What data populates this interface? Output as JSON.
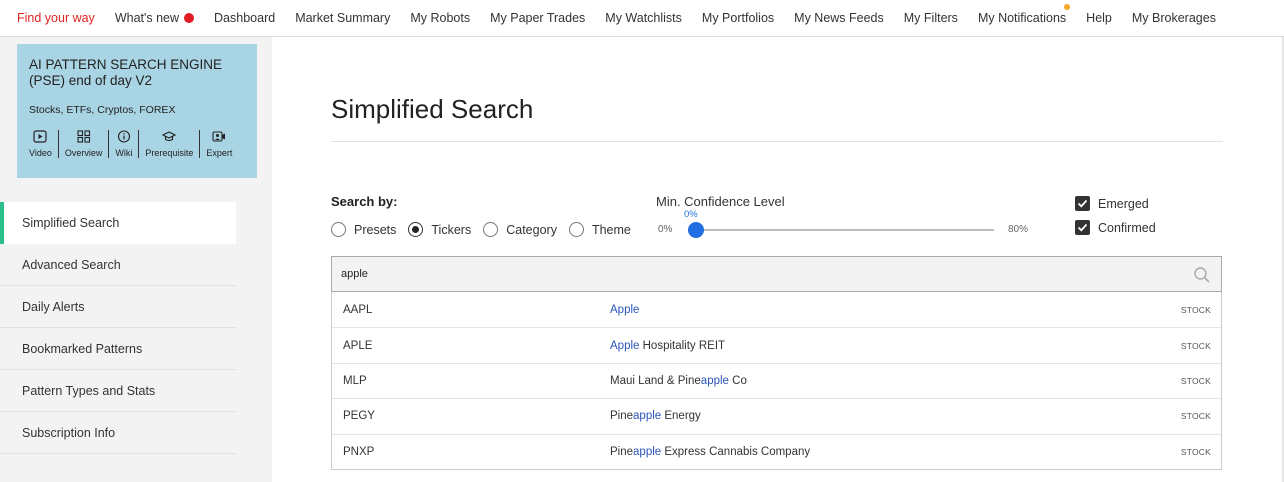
{
  "topnav": {
    "items": [
      {
        "label": "Find your way"
      },
      {
        "label": "What's new"
      },
      {
        "label": "Dashboard"
      },
      {
        "label": "Market Summary"
      },
      {
        "label": "My Robots"
      },
      {
        "label": "My Paper Trades"
      },
      {
        "label": "My Watchlists"
      },
      {
        "label": "My Portfolios"
      },
      {
        "label": "My News Feeds"
      },
      {
        "label": "My Filters"
      },
      {
        "label": "My Notifications"
      },
      {
        "label": "Help"
      },
      {
        "label": "My Brokerages"
      }
    ],
    "accent_color": "#e02424",
    "new_dot_color": "#e31b23",
    "notif_dot_color": "#f5a623"
  },
  "pse_card": {
    "title": "AI PATTERN SEARCH ENGINE (PSE) end of day V2",
    "subtitle": "Stocks, ETFs, Cryptos, FOREX",
    "links": [
      {
        "label": "Video",
        "icon": "video-icon"
      },
      {
        "label": "Overview",
        "icon": "overview-grid-icon"
      },
      {
        "label": "Wiki",
        "icon": "info-icon"
      },
      {
        "label": "Prerequisite",
        "icon": "graduation-cap-icon"
      },
      {
        "label": "Expert",
        "icon": "expert-video-icon"
      }
    ],
    "background": "#a9d4e4"
  },
  "side_menu": {
    "items": [
      {
        "label": "Simplified Search",
        "active": true
      },
      {
        "label": "Advanced Search"
      },
      {
        "label": "Daily Alerts"
      },
      {
        "label": "Bookmarked Patterns"
      },
      {
        "label": "Pattern Types and Stats"
      },
      {
        "label": "Subscription Info"
      }
    ],
    "active_color": "#2bbf8a"
  },
  "main": {
    "title": "Simplified Search",
    "search_by_label": "Search by:",
    "radios": [
      {
        "label": "Presets",
        "checked": false
      },
      {
        "label": "Tickers",
        "checked": true
      },
      {
        "label": "Category",
        "checked": false
      },
      {
        "label": "Theme",
        "checked": false
      }
    ],
    "confidence": {
      "label": "Min. Confidence Level",
      "min_label": "0%",
      "max_label": "80%",
      "value_label": "0%",
      "value_fraction": 0.0,
      "color": "#1f6fe0"
    },
    "checkboxes": [
      {
        "label": "Emerged",
        "checked": true
      },
      {
        "label": "Confirmed",
        "checked": true
      }
    ],
    "search": {
      "value": "apple",
      "placeholder": ""
    },
    "results": [
      {
        "ticker": "AAPL",
        "name_pre": "",
        "name_hl": "Apple",
        "name_post": "",
        "type": "STOCK"
      },
      {
        "ticker": "APLE",
        "name_pre": "",
        "name_hl": "Apple",
        "name_post": " Hospitality REIT",
        "type": "STOCK"
      },
      {
        "ticker": "MLP",
        "name_pre": "Maui Land & Pine",
        "name_hl": "apple",
        "name_post": " Co",
        "type": "STOCK"
      },
      {
        "ticker": "PEGY",
        "name_pre": "Pine",
        "name_hl": "apple",
        "name_post": " Energy",
        "type": "STOCK"
      },
      {
        "ticker": "PNXP",
        "name_pre": "Pine",
        "name_hl": "apple",
        "name_post": " Express Cannabis Company",
        "type": "STOCK"
      }
    ],
    "highlight_color": "#2b55b8"
  }
}
